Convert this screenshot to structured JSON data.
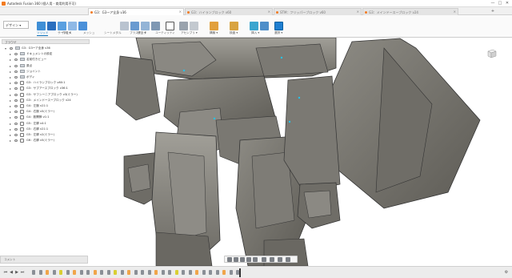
{
  "window": {
    "title": "Autodesk Fusion 360 (個人用 - 商用利用不可)",
    "controls": [
      "—",
      "□",
      "✕"
    ]
  },
  "doc_tabs": [
    {
      "label": "G3：G3ーア全身 v36",
      "active": true
    },
    {
      "label": "G3：ハイランブロック v60",
      "active": false
    },
    {
      "label": "STM：フリッパーブロック v60",
      "active": false
    },
    {
      "label": "G3：メインドースーブロック v24",
      "active": false
    }
  ],
  "ribbon": {
    "workspace": "デザイン ▾",
    "tabs": [
      "ソリッド",
      "サーフェス",
      "メッシュ",
      "シートメタル",
      "プラスチック",
      "ユーティリティ"
    ],
    "groups": [
      "作成 ▾",
      "修正 ▾",
      "アセンブリ ▾",
      "構築 ▾",
      "検査 ▾",
      "挿入 ▾",
      "選択 ▾"
    ],
    "accent": "#0b6fb8"
  },
  "browser": {
    "header": "ブラウザ",
    "rows": [
      {
        "label": "G3：G3ーア全身 v36",
        "indent": 0,
        "kind": "root"
      },
      {
        "label": "ドキュメントの設定",
        "indent": 1,
        "kind": "folder"
      },
      {
        "label": "名前付きビュー",
        "indent": 1,
        "kind": "folder"
      },
      {
        "label": "原点",
        "indent": 1,
        "kind": "folder"
      },
      {
        "label": "ジョイント",
        "indent": 1,
        "kind": "folder"
      },
      {
        "label": "ボディ",
        "indent": 1,
        "kind": "folder"
      },
      {
        "label": "G3：ハイランブロック v60:1",
        "indent": 1,
        "kind": "link"
      },
      {
        "label": "G3：サブアースブロック v36:1",
        "indent": 1,
        "kind": "link"
      },
      {
        "label": "G3：サフシーニアブロック v3(ミラー)",
        "indent": 1,
        "kind": "link"
      },
      {
        "label": "G3：メインドースーブロック v24",
        "indent": 1,
        "kind": "link"
      },
      {
        "label": "G4：左腕 v21:1",
        "indent": 1,
        "kind": "link"
      },
      {
        "label": "G4：右腕 v5(ミラー)",
        "indent": 1,
        "kind": "link"
      },
      {
        "label": "G4：股関節 v1:1",
        "indent": 1,
        "kind": "link"
      },
      {
        "label": "G5：左脚 v4:1",
        "indent": 1,
        "kind": "link"
      },
      {
        "label": "G5：右脚 v21:1",
        "indent": 1,
        "kind": "link"
      },
      {
        "label": "G5：左脚 v2(ミラー)",
        "indent": 1,
        "kind": "link"
      },
      {
        "label": "G6：右脚 v5(ミラー)",
        "indent": 1,
        "kind": "link"
      }
    ]
  },
  "comment_bar": "コメント",
  "timeline": {
    "controls": [
      "⏮",
      "◀",
      "▶",
      "⏭"
    ]
  }
}
